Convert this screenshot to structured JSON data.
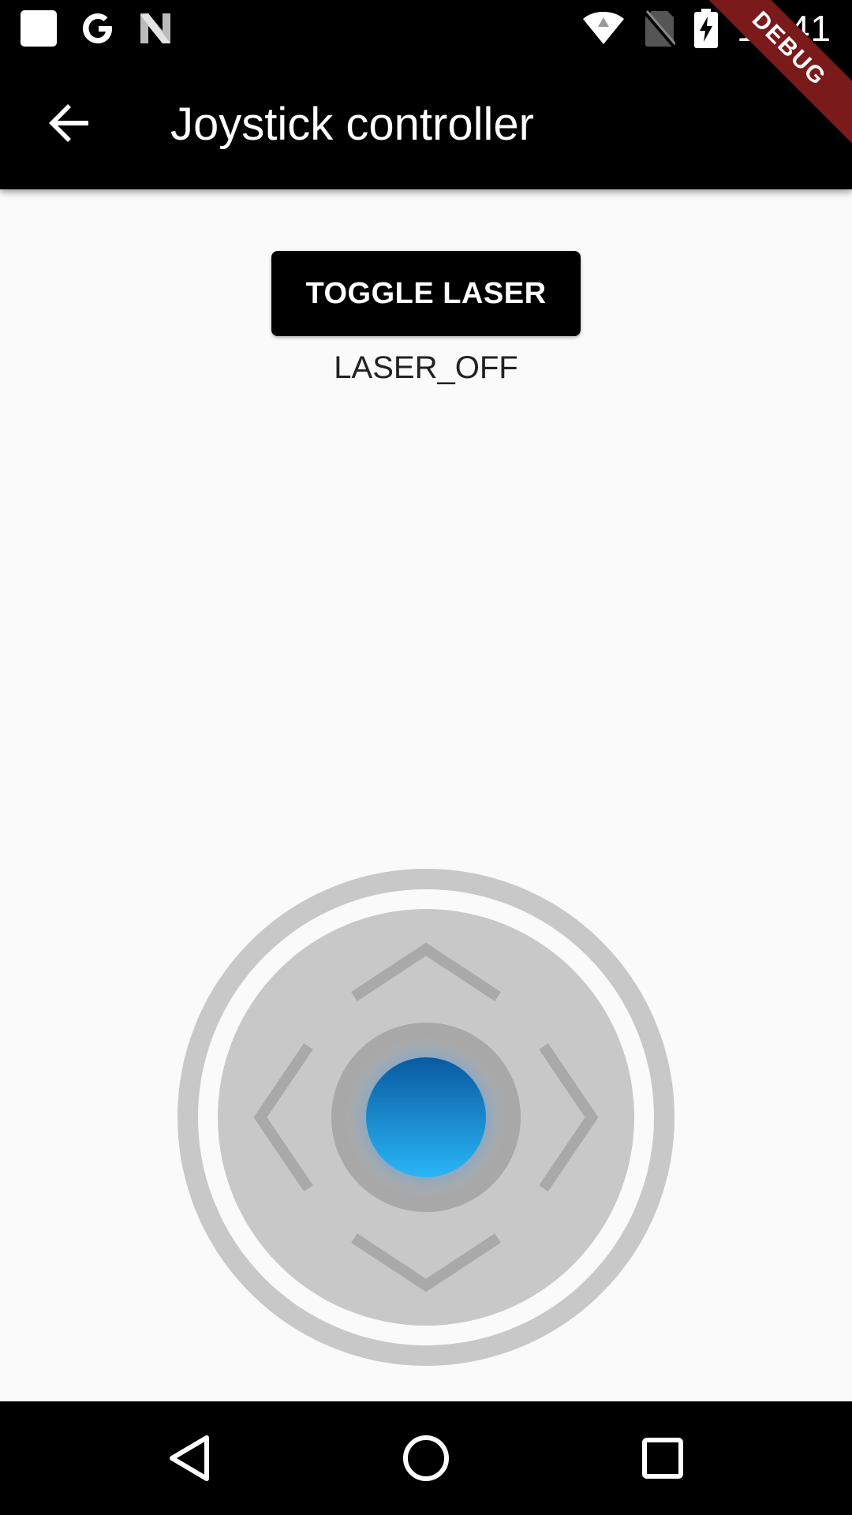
{
  "status_bar": {
    "time": "17:41",
    "icons": [
      "square-notification-icon",
      "google-g-icon",
      "n-logo-icon",
      "wifi-icon",
      "no-sim-icon",
      "battery-charging-icon"
    ]
  },
  "debug_banner": "DEBUG",
  "app_bar": {
    "title": "Joystick controller",
    "back_icon": "arrow-back-icon"
  },
  "laser": {
    "button_label": "TOGGLE LASER",
    "status": "LASER_OFF"
  },
  "joystick": {
    "knob_color": "#1e88e5",
    "base_color": "#c8c8c8",
    "arrow_icons": [
      "chevron-up-icon",
      "chevron-down-icon",
      "chevron-left-icon",
      "chevron-right-icon"
    ]
  },
  "nav_bar": {
    "buttons": [
      "back-triangle-icon",
      "home-circle-icon",
      "recents-square-icon"
    ]
  },
  "colors": {
    "bar_background": "#000000",
    "page_background": "#fafafa",
    "debug_ribbon": "#7a1a1a"
  }
}
